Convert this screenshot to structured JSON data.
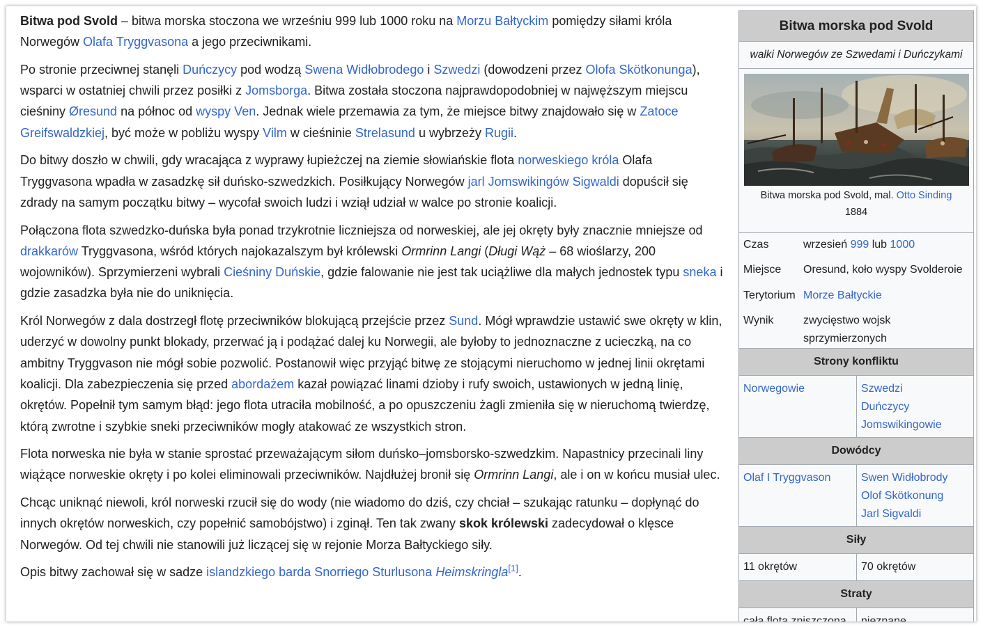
{
  "article": {
    "p1": {
      "bold": "Bitwa pod Svold",
      "t1": " – bitwa morska stoczona we wrześniu 999 lub 1000 roku na ",
      "l1": "Morzu Bałtyckim",
      "t2": " pomiędzy siłami króla Norwegów ",
      "l2": "Olafa Tryggvasona",
      "t3": " a jego przeciwnikami."
    },
    "p2": {
      "t1": "Po stronie przeciwnej stanęli ",
      "l1": "Duńczycy",
      "t2": " pod wodzą ",
      "l2": "Swena Widłobrodego",
      "t3": " i ",
      "l3": "Szwedzi",
      "t4": " (dowodzeni przez ",
      "l4": "Olofa Skötkonunga",
      "t5": "), wsparci w ostatniej chwili przez posiłki z ",
      "l5": "Jomsborga",
      "t6": ". Bitwa została stoczona najprawdopodobniej w najwęższym miejscu cieśniny ",
      "l6": "Øresund",
      "t7": " na północ od ",
      "l7": "wyspy Ven",
      "t8": ". Jednak wiele przemawia za tym, że miejsce bitwy znajdowało się w ",
      "l8": "Zatoce Greifswaldzkiej",
      "t9": ", być może w pobliżu wyspy ",
      "l9": "Vilm",
      "t10": " w cieśninie ",
      "l10": "Strelasund",
      "t11": " u wybrzeży ",
      "l11": "Rugii",
      "t12": "."
    },
    "p3": {
      "t1": "Do bitwy doszło w chwili, gdy wracająca z wyprawy łupieżczej na ziemie słowiańskie flota ",
      "l1": "norweskiego króla",
      "t2": " Olafa Tryggvasona wpadła w zasadzkę sił duńsko-szwedzkich. Posiłkujący Norwegów ",
      "l2": "jarl Jomswikingów Sigwaldi",
      "t3": " dopuścił się zdrady na samym początku bitwy – wycofał swoich ludzi i wziął udział w walce po stronie koalicji."
    },
    "p4": {
      "t1": "Połączona flota szwedzko-duńska była ponad trzykrotnie liczniejsza od norweskiej, ale jej okręty były znacznie mniejsze od ",
      "l1": "drakkarów",
      "t2": " Tryggvasona, wśród których najokazalszym był królewski ",
      "i1": "Ormrinn Langi",
      "t3": " (",
      "i2": "Długi Wąż",
      "t4": " – 68 wioślarzy, 200 wojowników). Sprzymierzeni wybrali ",
      "l2": "Cieśniny Duńskie",
      "t5": ", gdzie falowanie nie jest tak uciążliwe dla małych jednostek typu ",
      "l3": "sneka",
      "t6": " i gdzie zasadzka była nie do uniknięcia."
    },
    "p5": {
      "t1": "Król Norwegów z dala dostrzegł flotę przeciwników blokującą przejście przez ",
      "l1": "Sund",
      "t2": ". Mógł wprawdzie ustawić swe okręty w klin, uderzyć w dowolny punkt blokady, przerwać ją i podążać dalej ku Norwegii, ale byłoby to jednoznaczne z ucieczką, na co ambitny Tryggvason nie mógł sobie pozwolić. Postanowił więc przyjąć bitwę ze stojącymi nieruchomo w jednej linii okrętami koalicji. Dla zabezpieczenia się przed ",
      "l2": "abordażem",
      "t3": " kazał powiązać linami dzioby i rufy swoich, ustawionych w jedną linię, okrętów. Popełnił tym samym błąd: jego flota utraciła mobilność, a po opuszczeniu żagli zmieniła się w nieruchomą twierdzę, którą zwrotne i szybkie sneki przeciwników mogły atakować ze wszystkich stron."
    },
    "p6": {
      "t1": "Flota norweska nie była w stanie sprostać przeważającym siłom duńsko–jomsborsko-szwedzkim. Napastnicy przecinali liny wiążące norweskie okręty i po kolei eliminowali przeciwników. Najdłużej bronił się ",
      "i1": "Ormrinn Langi",
      "t2": ", ale i on w końcu musiał ulec."
    },
    "p7": {
      "t1": "Chcąc uniknąć niewoli, król norweski rzucił się do wody (nie wiadomo do dziś, czy chciał – szukając ratunku – dopłynąć do innych okrętów norweskich, czy popełnić samobójstwo) i zginął. Ten tak zwany ",
      "b1": "skok królewski",
      "t2": " zadecydował o klęsce Norwegów. Od tej chwili nie stanowili już liczącej się w rejonie Morza Bałtyckiego siły."
    },
    "p8": {
      "t1": "Opis bitwy zachował się w sadze ",
      "l1": "islandzkiego barda Snorriego Sturlusona",
      "t2": " ",
      "li1": "Heimskringla",
      "ref": "[1]",
      "t3": "."
    }
  },
  "infobox": {
    "title": "Bitwa morska pod Svold",
    "subtitle": "walki Norwegów ze Szwedami i Duńczykami",
    "caption_text": "Bitwa morska pod Svold, mal. ",
    "caption_link": "Otto Sinding",
    "caption_year": "1884",
    "rows": {
      "time_label": "Czas",
      "time_prefix": "wrzesień ",
      "time_link1": "999",
      "time_mid": " lub ",
      "time_link2": "1000",
      "place_label": "Miejsce",
      "place_value": "Oresund, koło wyspy Svolderoie",
      "territory_label": "Terytorium",
      "territory_value": "Morze Bałtyckie",
      "result_label": "Wynik",
      "result_value": "zwycięstwo wojsk sprzymierzonych"
    },
    "sides_header": "Strony konfliktu",
    "sides_left": [
      "Norwegowie"
    ],
    "sides_right": [
      "Szwedzi",
      "Duńczycy",
      "Jomswikingowie"
    ],
    "commanders_header": "Dowódcy",
    "commanders_left": [
      "Olaf I Tryggvason"
    ],
    "commanders_right": [
      "Swen Widłobrody",
      "Olof Skötkonung",
      "Jarl Sigvaldi"
    ],
    "forces_header": "Siły",
    "forces_left": "11 okrętów",
    "forces_right": "70 okrętów",
    "losses_header": "Straty",
    "losses_left": "cała flota zniszczona",
    "losses_right": "nieznane"
  }
}
